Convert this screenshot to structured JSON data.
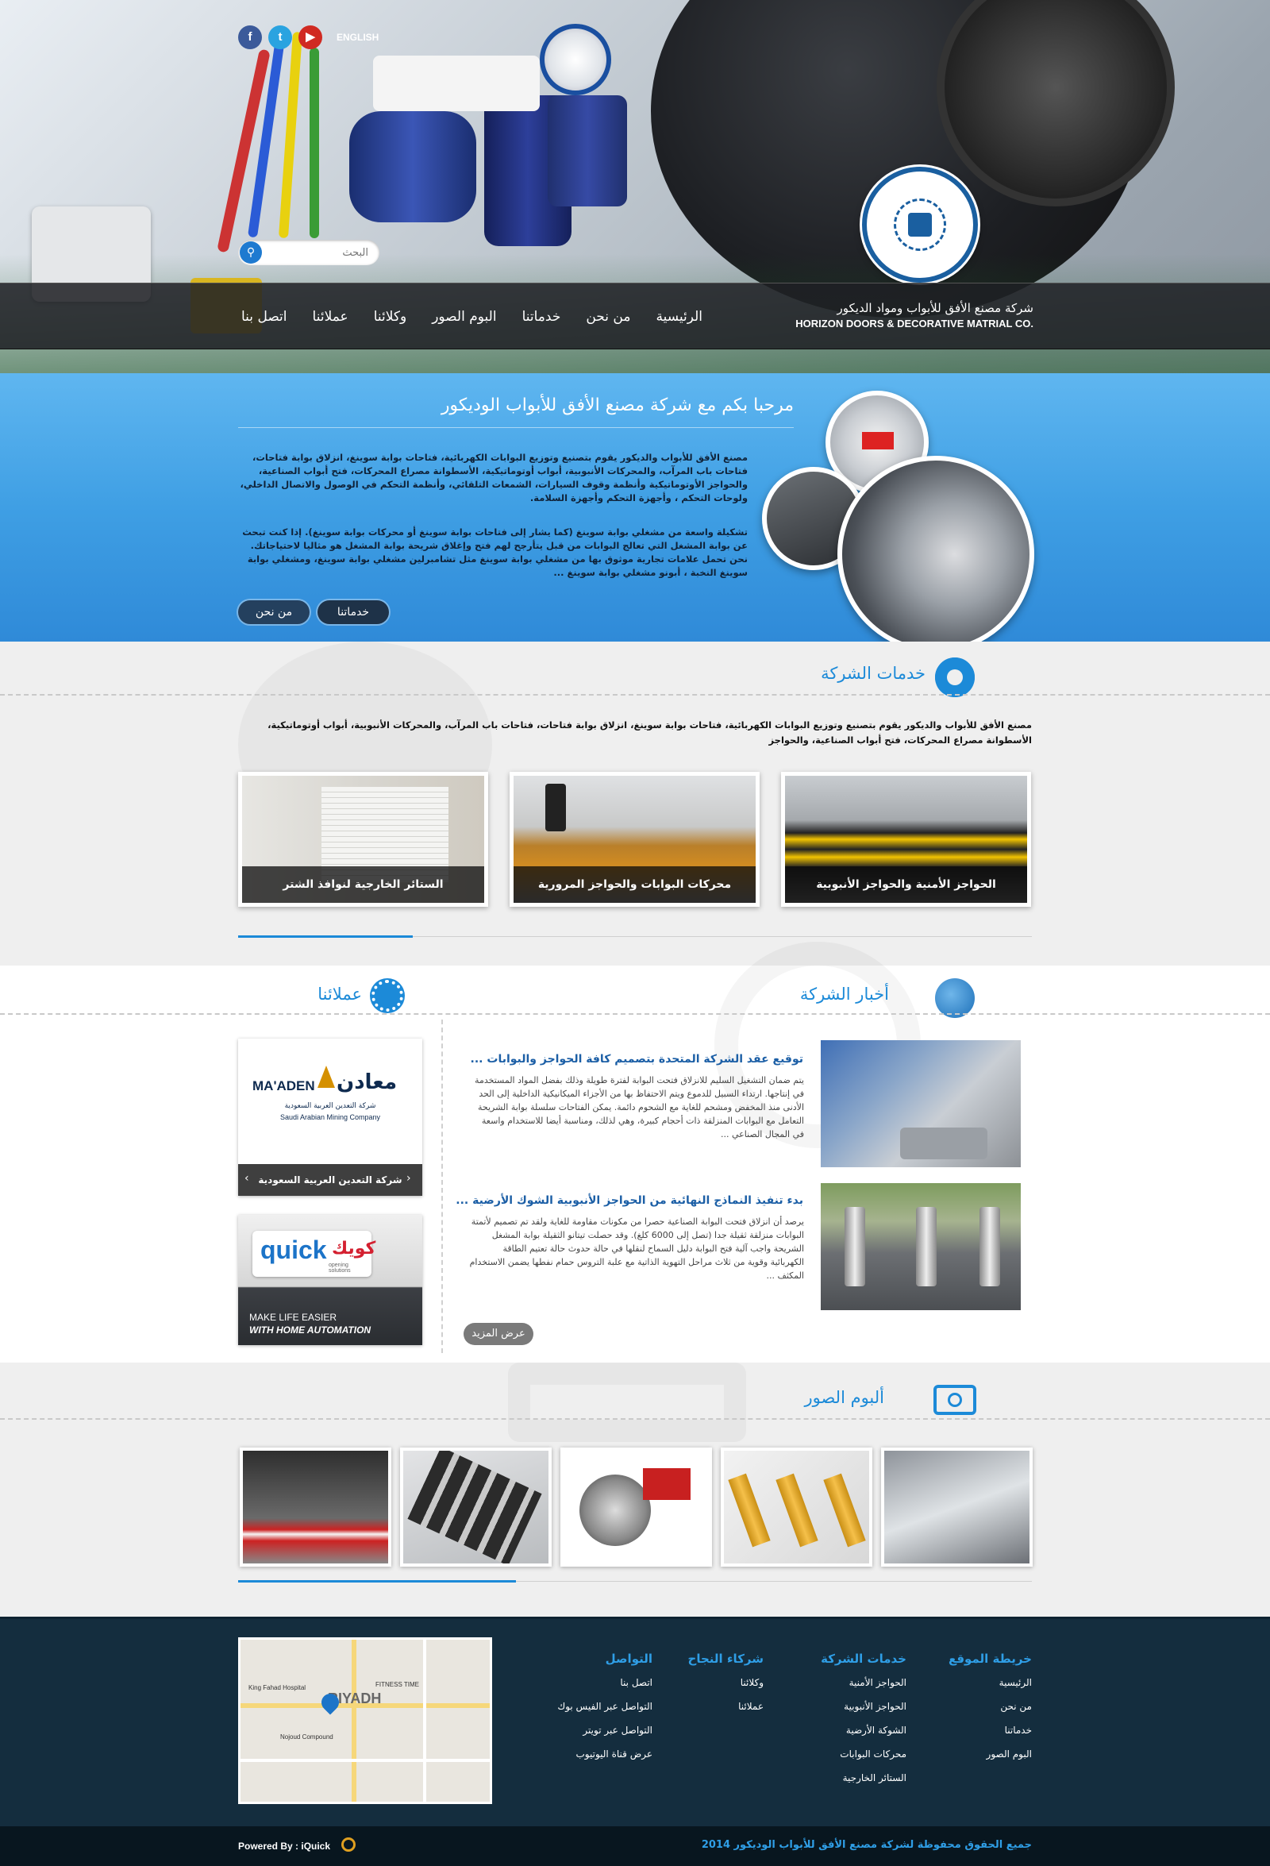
{
  "header": {
    "lang": "ENGLISH",
    "company_ar": "شركة مصنع الأفق للأبواب ومواد الديكور",
    "company_en": "HORIZON DOORS & DECORATIVE MATRIAL CO.",
    "search_placeholder": "البحث",
    "social": [
      "facebook-icon",
      "twitter-icon",
      "youtube-icon"
    ],
    "nav": [
      "الرئيسية",
      "من نحن",
      "خدماتنا",
      "البوم الصور",
      "وكلائنا",
      "عملائنا",
      "اتصل بنا"
    ]
  },
  "welcome": {
    "title": "مرحبا بكم مع شركة مصنع الأفق للأبواب الوديكور",
    "p1": "مصنع الأفق للأبواب والديكور يقوم بتصنيع وتوزيع البوابات الكهربائية، فتاحات بوابة سوينغ، انزلاق بوابة فتاحات، فتاحات باب المرآب، والمحركات الأنبوبية، أبواب أوتوماتيكية، الأسطوانة مصراع المحركات، فتح أبواب الصناعية، والحواجز الأوتوماتيكية وأنظمة وقوف السيارات، الشمعات التلقائي، وأنظمة التحكم في الوصول والاتصال الداخلي، ولوحات التحكم ، وأجهزة التحكم وأجهزة السلامة.",
    "p2": "تشكيلة واسعة من مشغلي بوابة سوينغ (كما يشار إلى فتاحات بوابة سوينغ أو محركات بوابة سوينغ). إذا كنت تبحث عن بوابة المشغل التي تعالج البوابات من قبل يتأرجح لهم فتح وإغلاق شريحة بوابة المشغل هو مثاليا لاحتياجاتك. نحن تحمل علامات تجارية موثوق بها من مشغلي بوابة سوينغ مثل تشامبرلين مشغلي بوابة سوينغ، ومشغلي بوابة سوينغ النخبة ، أبونو مشغلي بوابة سوينغ ...",
    "btn_services": "خدماتنا",
    "btn_about": "من نحن"
  },
  "services": {
    "title": "خدمات الشركة",
    "desc": "مصنع الأفق للأبواب والديكور يقوم بتصنيع وتوزيع البوابات الكهربائية، فتاحات بوابة سوينغ، انزلاق بوابة فتاحات، فتاحات باب المرآب، والمحركات الأنبوبية، أبواب أوتوماتيكية، الأسطوانة مصراع المحركات، فتح أبواب الصناعية، والحواجز",
    "cards": [
      "الحواجز الأمنية والحواجز الأنبوبية",
      "محركات البوابات والحواجز المرورية",
      "الستائر الخارجية لنوافذ الشتر"
    ]
  },
  "news": {
    "title": "أخبار الشركة",
    "items": [
      {
        "title": "توقيع عقد الشركة المتحدة بتصميم كافة الحواجز والبوابات ...",
        "body": "يتم ضمان التشغيل السليم للانزلاق فتحت البوابة لفترة طويلة وذلك بفضل المواد المستخدمة في إنتاجها. ارتداء السبيل للدموع ويتم الاحتفاظ بها من الأجزاء الميكانيكية الداخلية إلى الحد الأدنى منذ المخفض ومشحم للغاية مع الشحوم دائمة. يمكن الفتاحات سلسلة بوابة الشريحة التعامل مع البوابات المنزلقة ذات أحجام كبيرة، وهي لذلك، ومناسبة أيضا للاستخدام واسعة في المجال الصناعي ..."
      },
      {
        "title": "بدء تنفيذ النماذج النهائية من الحواجز الأنبوبية الشوك الأرضية ...",
        "body": "يرصد أن انزلاق فتحت البوابة الصناعية حصرا من مكونات مقاومة للغاية ولقد تم تصميم لأتمتة البوابات منزلقة ثقيلة جدا (تصل إلى 6000 كلغ). وقد حصلت تيتانو الثقيلة بوابة المشغل الشريحة واجب آلية فتح البوابة دليل السماح لنقلها في حالة حدوث حالة تعتيم الطاقة الكهربائية وقوية من ثلاث مراحل التهوية الذاتية مع علبة التروس حمام نفطها يضمن الاستخدام المكثف ..."
      }
    ],
    "more": "عرض المزيد"
  },
  "clients": {
    "title": "عملائنا",
    "maaden_en": "MA'ADEN",
    "maaden_ar": "معادن",
    "maaden_sub": "شركة التعدين العربية السعودية",
    "maaden_sub_en": "Saudi Arabian Mining Company",
    "slider_caption": "شركة التعدين العربية السعودية",
    "quick_logo": "quick",
    "quick_ar": "كويك",
    "quick_sub": "opening solutions",
    "quick_line1": "MAKE LIFE EASIER",
    "quick_line2": "WITH HOME AUTOMATION"
  },
  "gallery": {
    "title": "ألبوم الصور"
  },
  "footer": {
    "cols": [
      {
        "title": "خريطة الموقع",
        "links": [
          "الرئيسية",
          "من نحن",
          "خدماتنا",
          "البوم الصور"
        ]
      },
      {
        "title": "خدمات الشركة",
        "links": [
          "الحواجز الأمنية",
          "الحواجز الأنبوبية",
          "الشوكة الأرضية",
          "محركات البوابات",
          "الستائر الخارجية"
        ]
      },
      {
        "title": "شركاء النجاح",
        "links": [
          "وكلائنا",
          "عملائنا"
        ]
      },
      {
        "title": "التواصل",
        "links": [
          "اتصل بنا",
          "التواصل عبر الفيس بوك",
          "التواصل عبر تويتر",
          "عرض قناة اليوتيوب"
        ]
      }
    ],
    "map_label": "RIYADH",
    "map_poi1": "King Fahad Hospital",
    "map_poi2": "FITNESS TIME",
    "map_poi3": "Nojoud Compound",
    "powered": "Powered By : iQuick",
    "copyright": "جميع الحقوق محفوظة لشركة مصنع الأفق للأبواب الوديكور 2014"
  },
  "colors": {
    "accent": "#1c8ad8",
    "footer_bg": "#142d3e",
    "welcome_bg": "#3f9fe4"
  }
}
